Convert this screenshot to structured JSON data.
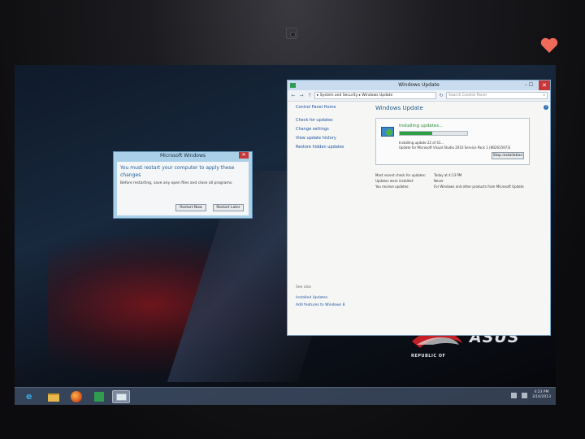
{
  "wu_window": {
    "title": "Windows Update",
    "minmax": "–  ☐",
    "close_glyph": "✕",
    "address": "▸ System and Security ▸ Windows Update",
    "search_placeholder": "Search Control Panel",
    "search_glyph": "⌕",
    "nav_back": "←",
    "nav_forward": "→",
    "nav_up": "↑",
    "refresh": "↻",
    "sidebar": {
      "home": "Control Panel Home",
      "links": [
        "Check for updates",
        "Change settings",
        "View update history",
        "Restore hidden updates"
      ],
      "see_also": "See also",
      "bottom_links": [
        "Installed Updates",
        "Add features to Windows 8"
      ]
    },
    "main": {
      "heading": "Windows Update",
      "status": "Installing updates...",
      "progress_fraction": 0.48,
      "progress_line1": "Installing update 22 of 41...",
      "progress_line2": "Update for Microsoft Visual Studio 2010 Service Pack 1 (KB2635973)",
      "stop_button": "Stop installation",
      "info": [
        {
          "key": "Most recent check for updates:",
          "value": "Today at 4:13 PM"
        },
        {
          "key": "Updates were installed:",
          "value": "Never"
        },
        {
          "key": "You receive updates:",
          "value": "For Windows and other products from Microsoft Update"
        }
      ]
    },
    "help_glyph": "?"
  },
  "dialog": {
    "title": "Microsoft Windows",
    "close_glyph": "✕",
    "message": "You must restart your computer to apply these changes",
    "sub": "Before restarting, save any open files and close all programs.",
    "restart_now": "Restart Now",
    "restart_later": "Restart Later"
  },
  "wallpaper": {
    "brand_line": "REPUBLIC OF",
    "brand": "ASUS"
  },
  "taskbar": {
    "ie_glyph": "e",
    "clock_time": "4:23 PM",
    "clock_date": "3/16/2013"
  },
  "colors": {
    "accent_blue": "#1d5b96",
    "progress_green": "#2ea043",
    "close_red": "#c7383a"
  },
  "icons": [
    "internet-explorer-icon",
    "folder-icon",
    "firefox-icon",
    "store-icon",
    "window-icon",
    "update-shield-icon",
    "help-icon",
    "search-icon"
  ]
}
